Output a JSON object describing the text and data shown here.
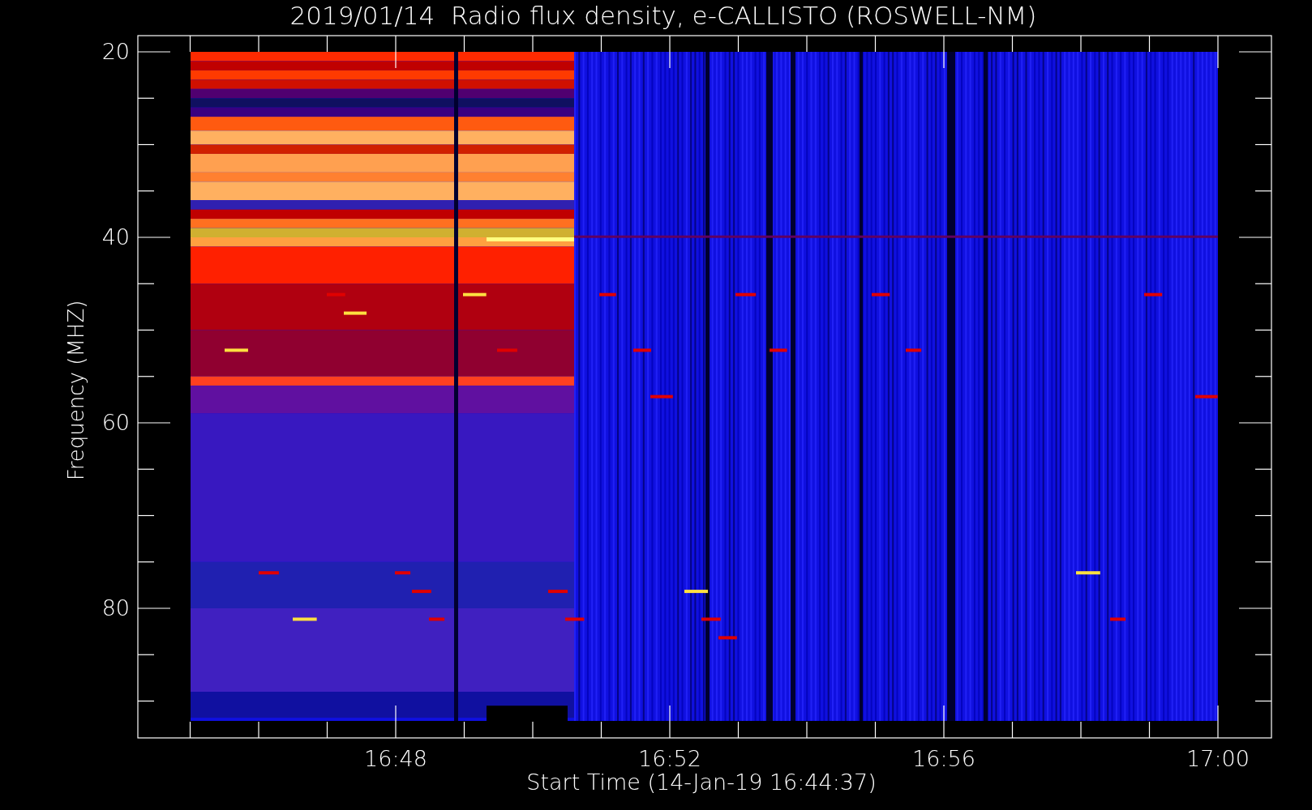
{
  "title": "2019/01/14  Radio flux density, e-CALLISTO (ROSWELL-NM)",
  "y_axis": {
    "label": "Frequency (MHZ)",
    "ticks": [
      "20",
      "40",
      "60",
      "80"
    ]
  },
  "x_axis": {
    "label": "Start Time (14-Jan-19 16:44:37)",
    "ticks": [
      "16:48",
      "16:52",
      "16:56",
      "17:00"
    ]
  }
}
